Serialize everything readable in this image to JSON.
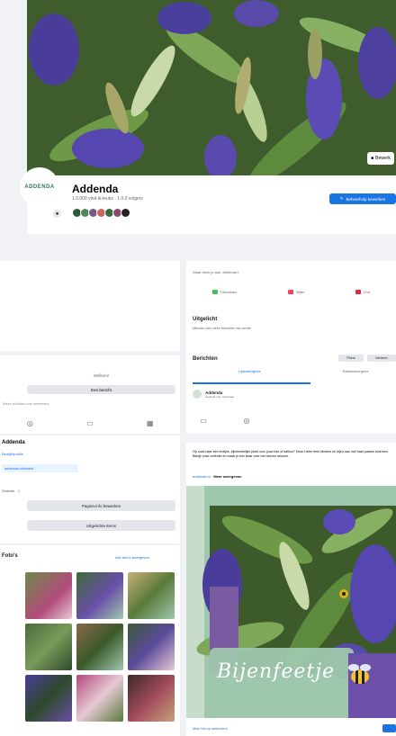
{
  "page": {
    "name": "Addenda",
    "meta": "1.0.000 vind-ik-leuks · 1.0.0 volgers",
    "primary_button_label": "Beheerhulp bewerken",
    "edit_cover_label": "Bewerk"
  },
  "left": {
    "welcome_title": "Welkom!",
    "welcome_button": "Een bericht",
    "welcome_note": "Alleen zichtbaar voor beheerders",
    "about_title": "Addenda",
    "about_line1": "Bedrijfsprofiel",
    "about_link": "addenda.nl/winkel",
    "about_line2": "Website · 1",
    "about_button1": "Pagina-info bewerken",
    "about_button2": "Uitgelichte items",
    "photos_title": "Foto's",
    "photos_link": "Alle foto's weergeven"
  },
  "composer": {
    "placeholder": "Waar denk je aan, Addenda?",
    "actions": [
      "Foto/video",
      "Bijlet",
      "Live"
    ]
  },
  "featured": {
    "title": "Uitgelicht",
    "subtitle": "Mensen zien deze berichten als eerste"
  },
  "posts": {
    "title": "Berichten",
    "filter": "Filters",
    "manage": "Beheren",
    "tab_list": "Lijstweergave",
    "tab_grid": "Rasterweergave",
    "author_name": "Addenda",
    "author_sub": "Gedeeld met: Openbaar"
  },
  "post": {
    "text": "Op zoek naar een vrolijke, bijvriendelijke plant voor jouw tuin of balkon? Deze Hebe trekt vlinders en bijen aan met haar paarse bloemen. Bekijk onze collectie en maak je tuin klaar voor het nieuwe seizoen.",
    "link_prefix": "addenda.nl",
    "link_bold": "Meer weergeven",
    "image_caption": "Bijenfeetje",
    "footer_text": "Meer info op addenda.nl"
  },
  "colors": {
    "accent": "#1b74e4",
    "hebe_purple": "#6b4fa8",
    "brand_green": "#2e7d4f"
  }
}
